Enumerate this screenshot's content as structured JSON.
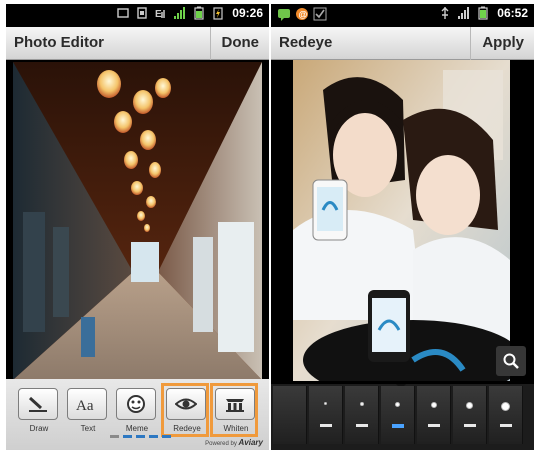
{
  "left_phone": {
    "status": {
      "time": "09:26",
      "icons": [
        "usb-icon",
        "data-sync-icon",
        "wifi-icon",
        "battery-icon",
        "signal-icon",
        "battery-charging-icon"
      ]
    },
    "title": "Photo Editor",
    "action": "Done",
    "photo": "corridor-lanterns",
    "tools": [
      {
        "label": "Draw",
        "icon": "draw-brush-icon",
        "selected": false
      },
      {
        "label": "Text",
        "icon": "text-aa-icon",
        "selected": false
      },
      {
        "label": "Meme",
        "icon": "meme-face-icon",
        "selected": false
      },
      {
        "label": "Redeye",
        "icon": "eye-icon",
        "selected": true
      },
      {
        "label": "Whiten",
        "icon": "teeth-icon",
        "selected": true
      }
    ],
    "page_dots": {
      "count": 5,
      "active": 1
    },
    "powered_by": "Powered by",
    "brand": "Aviary"
  },
  "right_phone": {
    "status": {
      "time": "06:52",
      "icons": [
        "message-icon",
        "email-icon",
        "checkmark-icon",
        "usb-icon",
        "signal-icon",
        "battery-icon"
      ]
    },
    "title": "Redeye",
    "action": "Apply",
    "photo": "two-women-with-phone",
    "brush_sizes": [
      {
        "size": 0,
        "selected": false
      },
      {
        "size": 2,
        "selected": false
      },
      {
        "size": 3,
        "selected": false
      },
      {
        "size": 4,
        "selected": true
      },
      {
        "size": 5,
        "selected": false
      },
      {
        "size": 6,
        "selected": false
      },
      {
        "size": 8,
        "selected": false
      }
    ],
    "zoom_icon": "magnifier-icon"
  },
  "colors": {
    "accent_selected": "#f09a3c",
    "page_dot_active": "#2d78c2",
    "brush_selected": "#4aa3ff"
  }
}
